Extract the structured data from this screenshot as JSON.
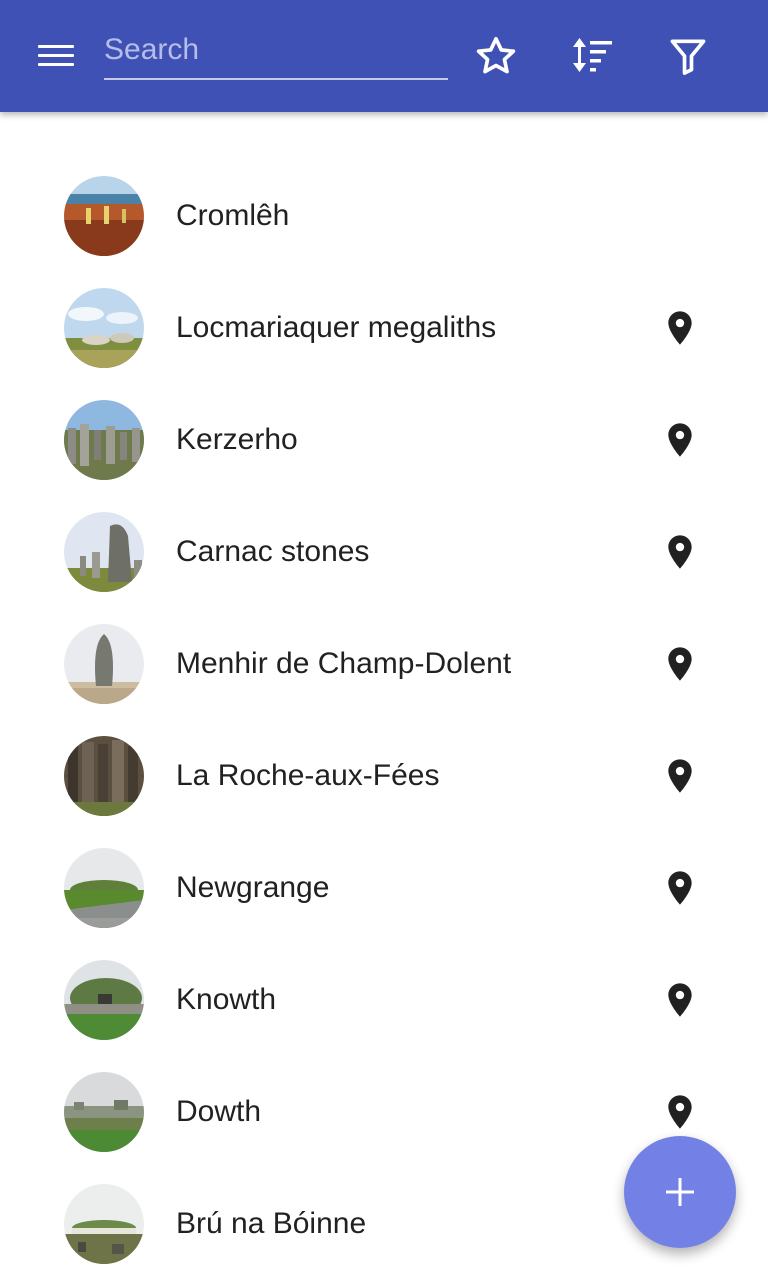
{
  "toolbar": {
    "search_placeholder": "Search",
    "menu_icon": "menu-icon",
    "favorites_icon": "star-outline-icon",
    "sort_icon": "sort-icon",
    "filter_icon": "filter-icon",
    "background_color": "#3f51b5"
  },
  "sites": [
    {
      "name": "Cromlêh",
      "has_location": false
    },
    {
      "name": "Locmariaquer megaliths",
      "has_location": true
    },
    {
      "name": "Kerzerho",
      "has_location": true
    },
    {
      "name": "Carnac stones",
      "has_location": true
    },
    {
      "name": "Menhir de Champ-Dolent",
      "has_location": true
    },
    {
      "name": "La Roche-aux-Fées",
      "has_location": true
    },
    {
      "name": "Newgrange",
      "has_location": true
    },
    {
      "name": "Knowth",
      "has_location": true
    },
    {
      "name": "Dowth",
      "has_location": true
    },
    {
      "name": "Brú na Bóinne",
      "has_location": false
    }
  ],
  "fab": {
    "icon": "plus-icon",
    "color": "#7380e6"
  }
}
